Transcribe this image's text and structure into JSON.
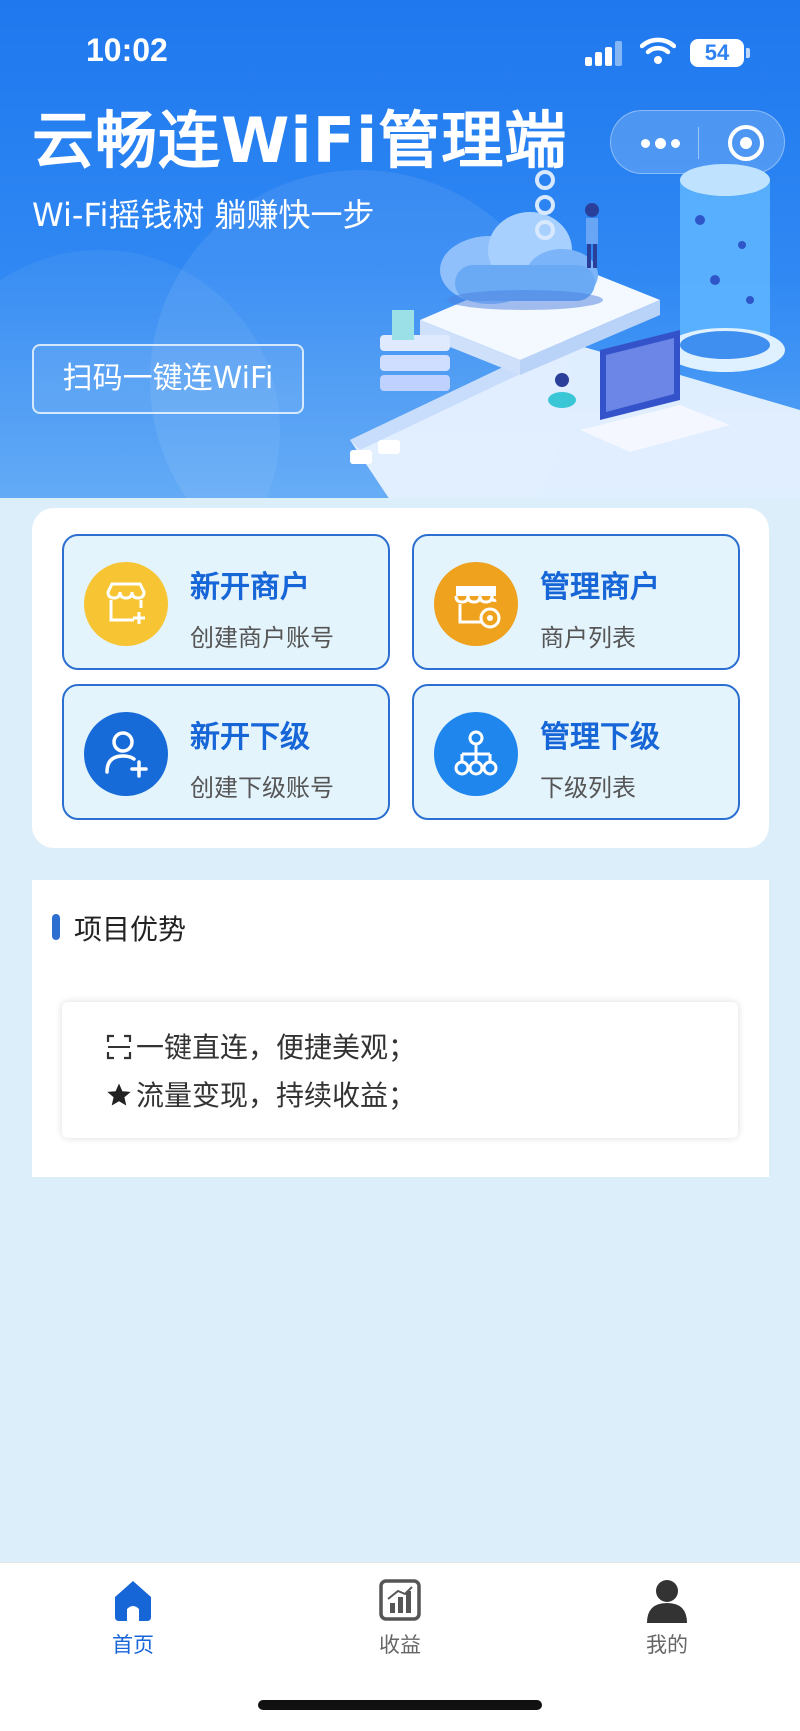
{
  "status_bar": {
    "time": "10:02",
    "battery": "54"
  },
  "hero": {
    "title": "云畅连WiFi管理端",
    "subtitle": "Wi-Fi摇钱树 躺赚快一步",
    "scan_button": "扫码一键连WiFi"
  },
  "grid": [
    {
      "title": "新开商户",
      "subtitle": "创建商户账号",
      "icon": "store-add-icon",
      "icon_color": "#f7c534"
    },
    {
      "title": "管理商户",
      "subtitle": "商户列表",
      "icon": "store-settings-icon",
      "icon_color": "#efa21d"
    },
    {
      "title": "新开下级",
      "subtitle": "创建下级账号",
      "icon": "user-add-icon",
      "icon_color": "#176bd9"
    },
    {
      "title": "管理下级",
      "subtitle": "下级列表",
      "icon": "org-tree-icon",
      "icon_color": "#1f86ee"
    }
  ],
  "advantages": {
    "title": "项目优势",
    "items": [
      {
        "text": "一键直连，便捷美观；",
        "icon": "scan-icon"
      },
      {
        "text": "流量变现，持续收益；",
        "icon": "star-icon"
      }
    ]
  },
  "tabbar": [
    {
      "label": "首页",
      "icon": "home-icon",
      "active": true
    },
    {
      "label": "收益",
      "icon": "chart-icon",
      "active": false
    },
    {
      "label": "我的",
      "icon": "user-icon",
      "active": false
    }
  ],
  "colors": {
    "primary": "#1766d8",
    "hero_top": "#1f78ee",
    "page_bg": "#ddeefb",
    "tile_bg": "#e4f4fd"
  }
}
